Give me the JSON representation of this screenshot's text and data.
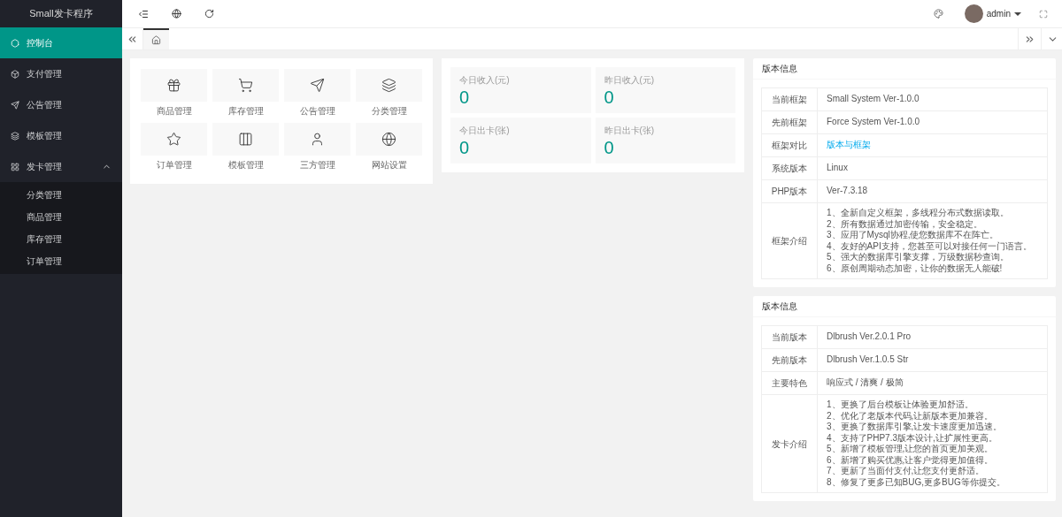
{
  "sidebar": {
    "title": "Small发卡程序",
    "items": [
      {
        "label": "控制台",
        "selected": true
      },
      {
        "label": "支付管理",
        "selected": false
      },
      {
        "label": "公告管理",
        "selected": false
      },
      {
        "label": "模板管理",
        "selected": false
      },
      {
        "label": "发卡管理",
        "selected": false,
        "expanded": true,
        "children": [
          {
            "label": "分类管理"
          },
          {
            "label": "商品管理"
          },
          {
            "label": "库存管理"
          },
          {
            "label": "订单管理"
          }
        ]
      }
    ]
  },
  "topbar": {
    "user": "admin"
  },
  "tabs": [
    {
      "selected": true
    }
  ],
  "shortcuts": [
    {
      "label": "商品管理"
    },
    {
      "label": "库存管理"
    },
    {
      "label": "公告管理"
    },
    {
      "label": "分类管理"
    },
    {
      "label": "订单管理"
    },
    {
      "label": "模板管理"
    },
    {
      "label": "三方管理"
    },
    {
      "label": "网站设置"
    }
  ],
  "stats": [
    {
      "label": "今日收入(元)",
      "value": "0"
    },
    {
      "label": "昨日收入(元)",
      "value": "0"
    },
    {
      "label": "今日出卡(张)",
      "value": "0"
    },
    {
      "label": "昨日出卡(张)",
      "value": "0"
    }
  ],
  "panels": [
    {
      "title": "版本信息",
      "rows": [
        {
          "label": "当前框架",
          "value": "Small System Ver-1.0.0"
        },
        {
          "label": "先前框架",
          "value": "Force System Ver-1.0.0"
        },
        {
          "label": "框架对比",
          "value": "版本与框架",
          "kind": "link"
        },
        {
          "label": "系统版本",
          "value": "Linux"
        },
        {
          "label": "PHP版本",
          "value": "Ver-7.3.18"
        },
        {
          "label": "框架介绍",
          "lines": [
            "1、全新自定义框架，多线程分布式数据读取。",
            "2、所有数据通过加密传输，安全稳定。",
            "3、应用了Mysql协程,使您数据库不在阵亡。",
            "4、友好的API支持，您甚至可以对接任何一门语言。",
            "5、强大的数据库引擎支撑，万级数据秒查询。",
            "6、原创周期动态加密，让你的数据无人能破!"
          ]
        }
      ]
    },
    {
      "title": "版本信息",
      "rows": [
        {
          "label": "当前版本",
          "value": "Dlbrush Ver.2.0.1 Pro"
        },
        {
          "label": "先前版本",
          "value": "Dlbrush Ver.1.0.5 Str"
        },
        {
          "label": "主要特色",
          "value": "响应式 / 清爽 / 极简"
        },
        {
          "label": "发卡介绍",
          "lines": [
            "1、更换了后台模板让体验更加舒适。",
            "2、优化了老版本代码,让新版本更加兼容。",
            "3、更换了数据库引擎,让发卡速度更加迅速。",
            "4、支持了PHP7.3版本设计,让扩展性更高。",
            "5、新增了模板管理,让您的首页更加美观。",
            "6、新增了购买优惠,让客户觉得更加值得。",
            "7、更新了当面付支付,让您支付更舒适。",
            "8、修复了更多已知BUG,更多BUG等你提交。"
          ]
        }
      ]
    }
  ]
}
